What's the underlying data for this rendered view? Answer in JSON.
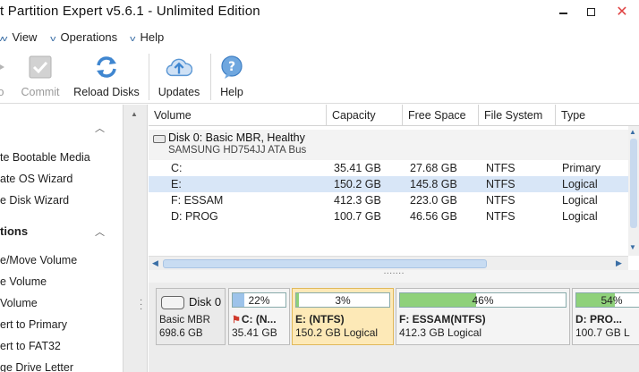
{
  "window": {
    "title": "t Partition Expert v5.6.1 - Unlimited Edition",
    "close_glyph": "✕"
  },
  "menu": [
    {
      "label": ""
    },
    {
      "label": "View"
    },
    {
      "label": "Operations"
    },
    {
      "label": "Help"
    }
  ],
  "toolbar": {
    "undo_label": "o",
    "commit_label": "Commit",
    "reload_label": "Reload Disks",
    "updates_label": "Updates",
    "help_label": "Help"
  },
  "sidebar": {
    "sections": [
      {
        "title": "",
        "items": [
          "te Bootable Media",
          "ate OS Wizard",
          "e Disk Wizard"
        ]
      },
      {
        "title": "tions",
        "items": [
          "e/Move Volume",
          "e Volume",
          "Volume",
          "ert to Primary",
          "ert to FAT32",
          "ge Drive Letter"
        ]
      }
    ]
  },
  "volume_list": {
    "columns": [
      "Volume",
      "Capacity",
      "Free Space",
      "File System",
      "Type"
    ],
    "disk": {
      "title": "Disk 0: Basic MBR, Healthy",
      "subtitle": "SAMSUNG HD754JJ ATA Bus"
    },
    "rows": [
      {
        "volume": "C:",
        "capacity": "35.41 GB",
        "free": "27.68 GB",
        "fs": "NTFS",
        "type": "Primary",
        "selected": false
      },
      {
        "volume": "E:",
        "capacity": "150.2 GB",
        "free": "145.8 GB",
        "fs": "NTFS",
        "type": "Logical",
        "selected": true
      },
      {
        "volume": "F: ESSAM",
        "capacity": "412.3 GB",
        "free": "223.0 GB",
        "fs": "NTFS",
        "type": "Logical",
        "selected": false
      },
      {
        "volume": "D: PROG",
        "capacity": "100.7 GB",
        "free": "46.56 GB",
        "fs": "NTFS",
        "type": "Logical",
        "selected": false
      }
    ]
  },
  "disk_map": {
    "disk_name": "Disk 0",
    "disk_type": "Basic MBR",
    "disk_size": "698.6 GB",
    "partitions": [
      {
        "pct_label": "22%",
        "used": 0.22,
        "name": "C: (N...",
        "size": "35.41 GB",
        "fill_color": "#9dc3ea",
        "selected": false,
        "flag": true
      },
      {
        "pct_label": "3%",
        "used": 0.03,
        "name": "E: (NTFS)",
        "size": "150.2 GB Logical",
        "fill_color": "#8fd17a",
        "selected": true,
        "flag": false
      },
      {
        "pct_label": "46%",
        "used": 0.46,
        "name": "F: ESSAM(NTFS)",
        "size": "412.3 GB Logical",
        "fill_color": "#8fd17a",
        "selected": false,
        "flag": false
      },
      {
        "pct_label": "54%",
        "used": 0.54,
        "name": "D: PRO...",
        "size": "100.7 GB L",
        "fill_color": "#8fd17a",
        "selected": false,
        "flag": false
      }
    ]
  }
}
